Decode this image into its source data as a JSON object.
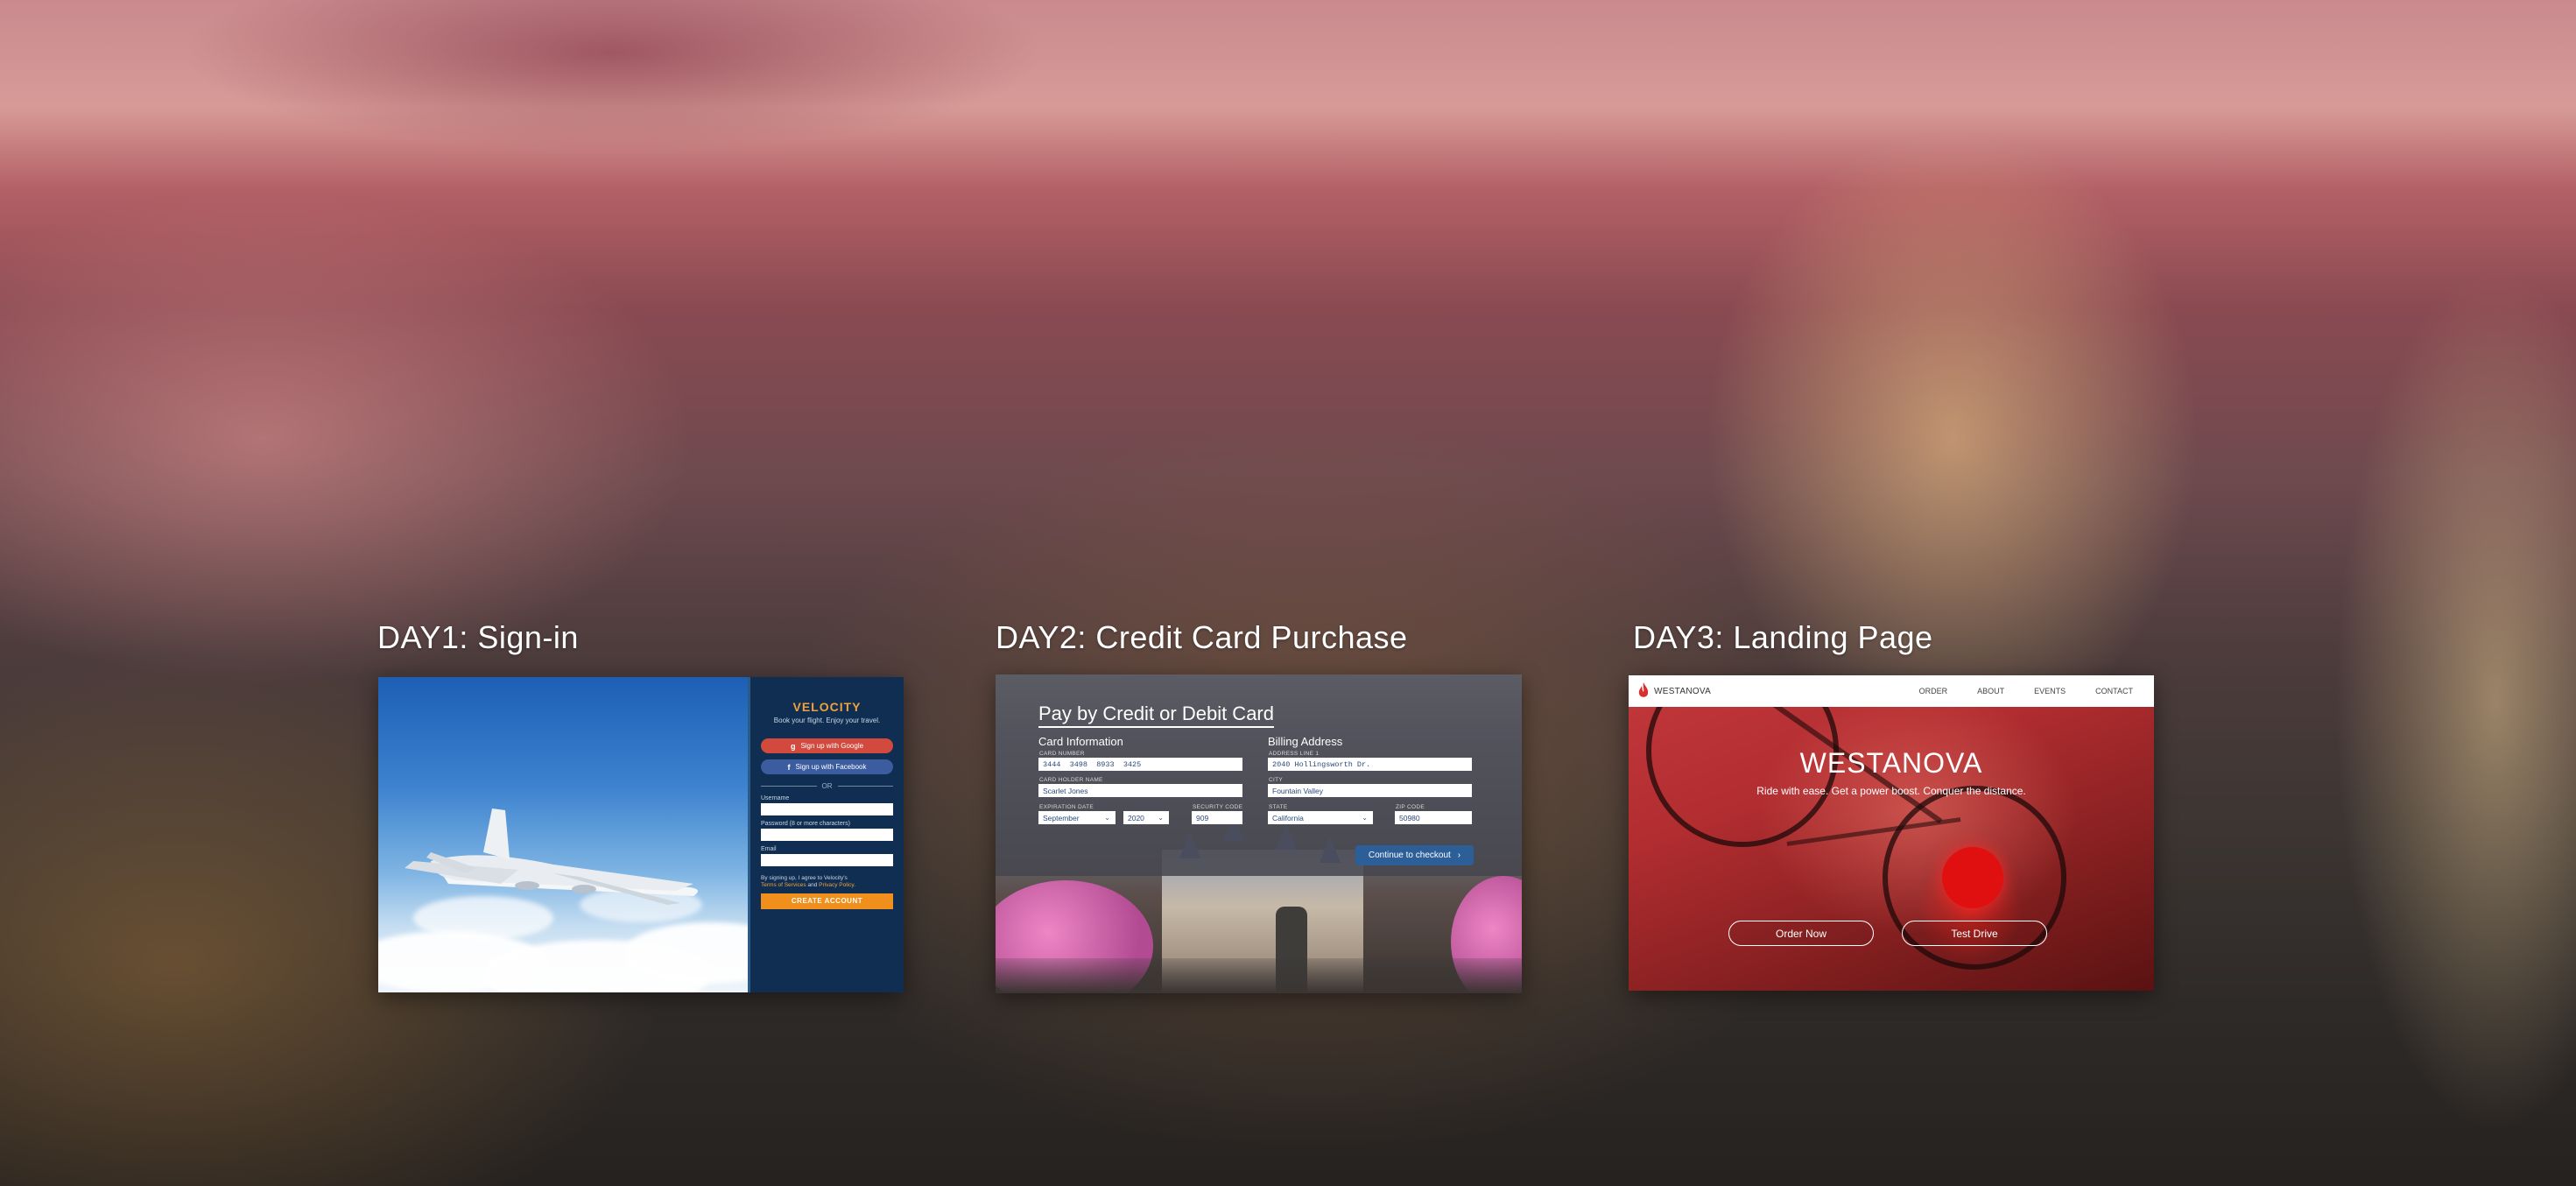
{
  "projects": [
    {
      "title": "DAY1: Sign-in",
      "signin": {
        "brand": "VELOCITY",
        "tagline": "Book your flight. Enjoy your travel.",
        "google_label": "Sign up with Google",
        "facebook_label": "Sign up with Facebook",
        "or_label": "OR",
        "username_label": "Username",
        "password_label": "Password (8 or more characters)",
        "email_label": "Email",
        "terms_prefix": "By signing up, I agree to Velocity's",
        "terms_link": "Terms of Services",
        "terms_and": "and",
        "privacy_link": "Privacy Policy.",
        "create_label": "CREATE ACCOUNT",
        "accent_color": "#f08f1c",
        "panel_color": "#0f2e52"
      }
    },
    {
      "title": "DAY2: Credit Card Purchase",
      "payment": {
        "heading": "Pay by Credit or Debit Card",
        "card_section": "Card Information",
        "billing_section": "Billing Address",
        "card_number_label": "CARD NUMBER",
        "card_number": "3444  3498  8933  3425",
        "card_holder_label": "CARD HOLDER NAME",
        "card_holder": "Scarlet Jones",
        "expiration_label": "EXPIRATION DATE",
        "exp_month": "September",
        "exp_year": "2020",
        "security_label": "SECURITY CODE",
        "security_code": "909",
        "address_label": "ADDRESS LINE 1",
        "address": "2040 Hollingsworth Dr.",
        "city_label": "CITY",
        "city": "Fountain Valley",
        "state_label": "STATE",
        "state": "California",
        "zip_label": "ZIP CODE",
        "zip": "50980",
        "checkout_label": "Continue to checkout",
        "accent_color": "#2c5e98"
      }
    },
    {
      "title": "DAY3: Landing Page",
      "landing": {
        "logo_text": "WESTANOVA",
        "nav": [
          "ORDER",
          "ABOUT",
          "EVENTS",
          "CONTACT"
        ],
        "hero_title": "WESTANOVA",
        "hero_subtitle": "Ride with ease. Get a power boost. Conquer the distance.",
        "order_label": "Order Now",
        "test_drive_label": "Test Drive",
        "accent_color": "#c0363a"
      }
    }
  ]
}
